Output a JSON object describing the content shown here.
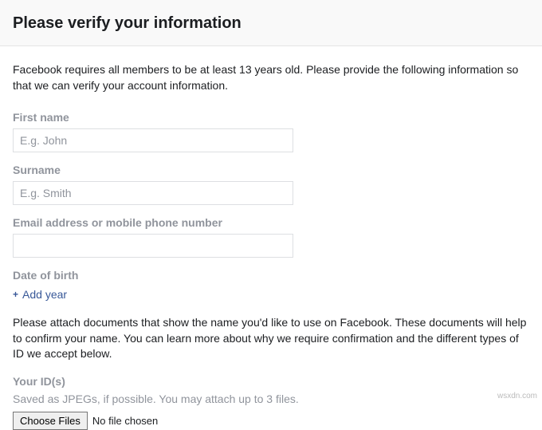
{
  "header": {
    "title": "Please verify your information"
  },
  "intro": "Facebook requires all members to be at least 13 years old. Please provide the following information so that we can verify your account information.",
  "fields": {
    "first_name": {
      "label": "First name",
      "placeholder": "E.g. John",
      "value": ""
    },
    "surname": {
      "label": "Surname",
      "placeholder": "E.g. Smith",
      "value": ""
    },
    "contact": {
      "label": "Email address or mobile phone number",
      "value": ""
    },
    "dob": {
      "label": "Date of birth",
      "add_year": "Add year"
    }
  },
  "attach_text": "Please attach documents that show the name you'd like to use on Facebook. These documents will help to confirm your name. You can learn more about why we require confirmation and the different types of ID we accept below.",
  "ids": {
    "label": "Your ID(s)",
    "hint": "Saved as JPEGs, if possible. You may attach up to 3 files.",
    "button": "Choose Files",
    "status": "No file chosen"
  },
  "watermark": "wsxdn.com"
}
